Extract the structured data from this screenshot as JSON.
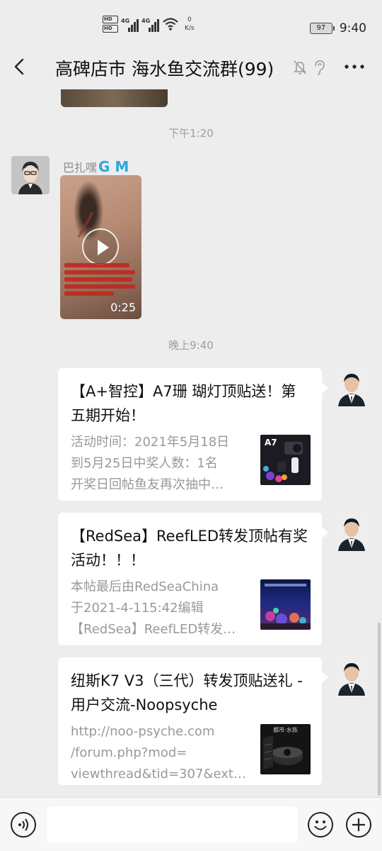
{
  "status_bar": {
    "hd1": "HD",
    "hd2": "HD",
    "net1": "4G",
    "net2": "4G",
    "speed_value": "0",
    "speed_unit": "K/s",
    "battery": "97",
    "time": "9:40"
  },
  "header": {
    "title": "高碑店市 海水鱼交流群(99)",
    "icons": [
      "back-arrow-icon",
      "mute-bell-icon",
      "earpiece-icon",
      "more-icon"
    ]
  },
  "messages": {
    "timestamp1": "下午1:20",
    "sender_name": "巴扎嘿",
    "sender_badge": "G M",
    "video_duration": "0:25",
    "timestamp2": "晚上9:40",
    "cards": [
      {
        "title": "【A+智控】A7珊 瑚灯顶贴送！第五期开始！",
        "desc1": "活动时间：2021年5月18日",
        "desc2": "到5月25日中奖人数：1名",
        "desc3": "开奖日回帖鱼友再次抽中…",
        "thumb_label": "A7"
      },
      {
        "title": "【RedSea】ReefLED转发顶帖有奖活动！！！",
        "desc1": "本帖最后由RedSeaChina",
        "desc2": "于2021-4-115:42编辑",
        "desc3": "【RedSea】ReefLED转发…"
      },
      {
        "title": "纽斯K7 V3（三代）转发顶贴送礼 - 用户交流-Noopsyche",
        "desc1": "http://noo-psyche.com",
        "desc2": "/forum.php?mod=",
        "desc3": "viewthread&tid=307&extr…",
        "thumb_label": "都市·水族"
      }
    ]
  },
  "input_bar": {
    "placeholder": "",
    "icons": [
      "voice-icon",
      "emoji-icon",
      "plus-icon"
    ]
  }
}
